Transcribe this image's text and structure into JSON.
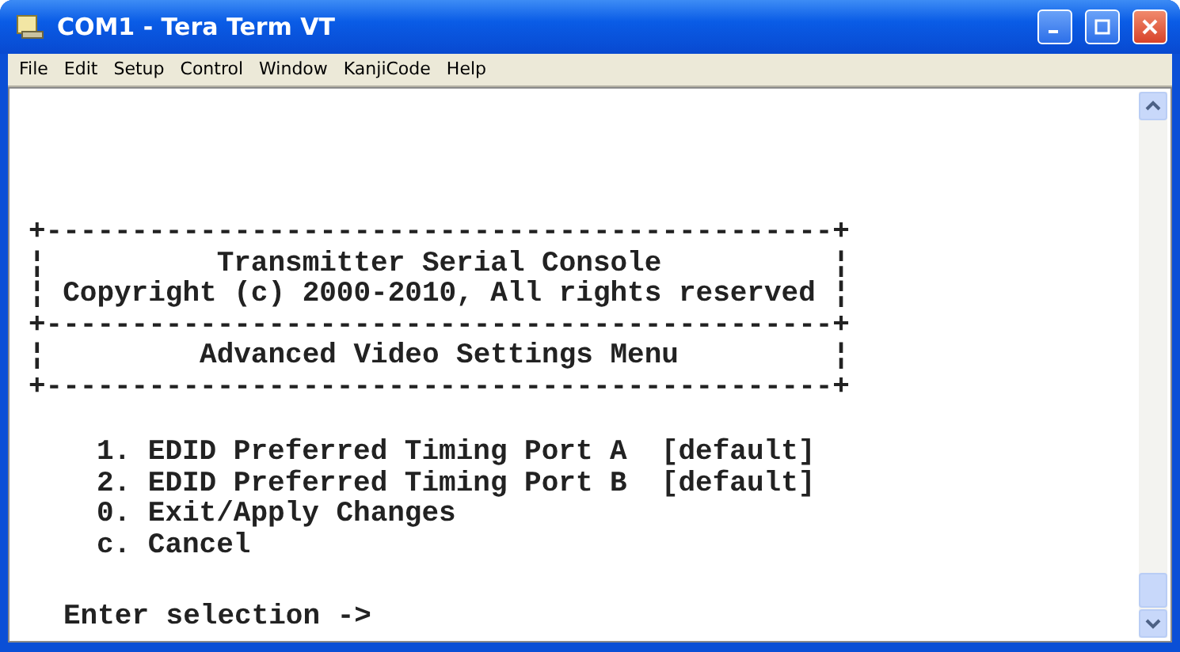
{
  "window": {
    "title": "COM1 - Tera Term VT"
  },
  "menu": [
    "File",
    "Edit",
    "Setup",
    "Control",
    "Window",
    "KanjiCode",
    "Help"
  ],
  "terminal": {
    "box_lines": [
      "+----------------------------------------------+",
      "¦          Transmitter Serial Console          ¦",
      "¦ Copyright (c) 2000-2010, All rights reserved ¦",
      "+----------------------------------------------+",
      "¦         Advanced Video Settings Menu         ¦",
      "+----------------------------------------------+"
    ],
    "items": [
      "1. EDID Preferred Timing Port A  [default]",
      "2. EDID Preferred Timing Port B  [default]",
      "0. Exit/Apply Changes",
      "c. Cancel"
    ],
    "prompt": "Enter selection ->"
  }
}
